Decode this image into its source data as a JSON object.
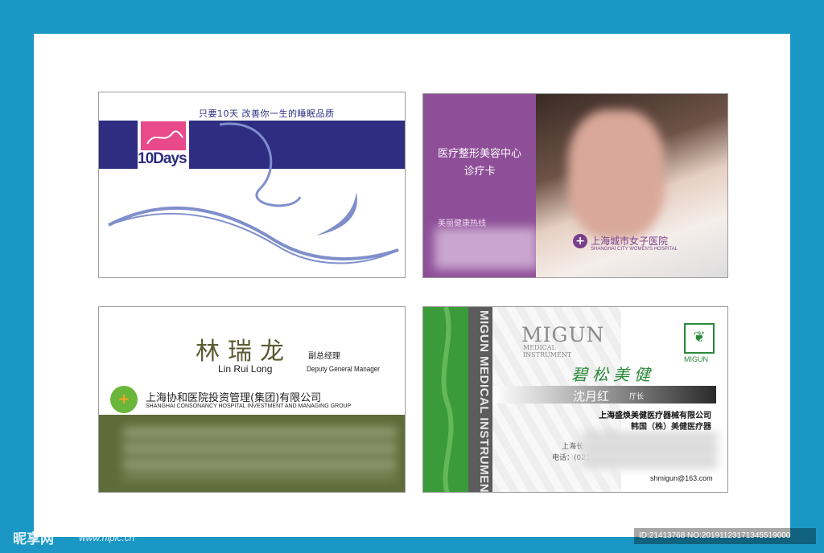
{
  "card1": {
    "slogan": "只要10天    改善你一生的睡眠品质",
    "logo_text": "10Days",
    "colors": {
      "band": "#2e2d82",
      "logo": "#e84a8a",
      "swoosh": "#7f8fcc"
    }
  },
  "card2": {
    "title_line1": "医疗整形美容中心",
    "title_line2": "诊疗卡",
    "hotline_label": "美丽健康热线",
    "hospital_name": "上海城市女子医院",
    "hospital_en": "SHANGHAI CITY WOMEN'S HOSPITAL",
    "icon": "cross-icon",
    "colors": {
      "panel": "#8e4f98"
    }
  },
  "card3": {
    "name_cn": "林瑞龙",
    "name_pinyin": "Lin Rui Long",
    "title_cn": "副总经理",
    "title_en": "Deputy General Manager",
    "company_cn": "上海协和医院投资管理(集团)有限公司",
    "company_en": "SHANGHAI CONSONANCY HOSPITAL INVESTMENT AND MANAGING GROUP",
    "logo_icon": "group-logo-icon",
    "colors": {
      "bottom": "#5f6c3a"
    }
  },
  "card4": {
    "vertical_text": "MIGUN MEDICAL INSTRUMENT",
    "brand": "MIGUN",
    "brand_sub": "MEDICAL\nINSTRUMENT",
    "logo_text": "MIGUN",
    "slogan": "碧松美健",
    "name": "沈月红",
    "role": "厅长",
    "company1": "上海盛焕美健医疗器械有限公司",
    "company2": "韩国（株）美健医疗器",
    "address_prefix": "上海长",
    "phone_prefix": "电话：(021",
    "email": "shmigun@163.com",
    "colors": {
      "green": "#3b9a3a",
      "brand_green": "#2a8a3a"
    }
  },
  "watermark": {
    "site": "昵享网",
    "url": "www.nipic.cn",
    "id_text": "ID:21413768 NO:20191123171345519000"
  }
}
